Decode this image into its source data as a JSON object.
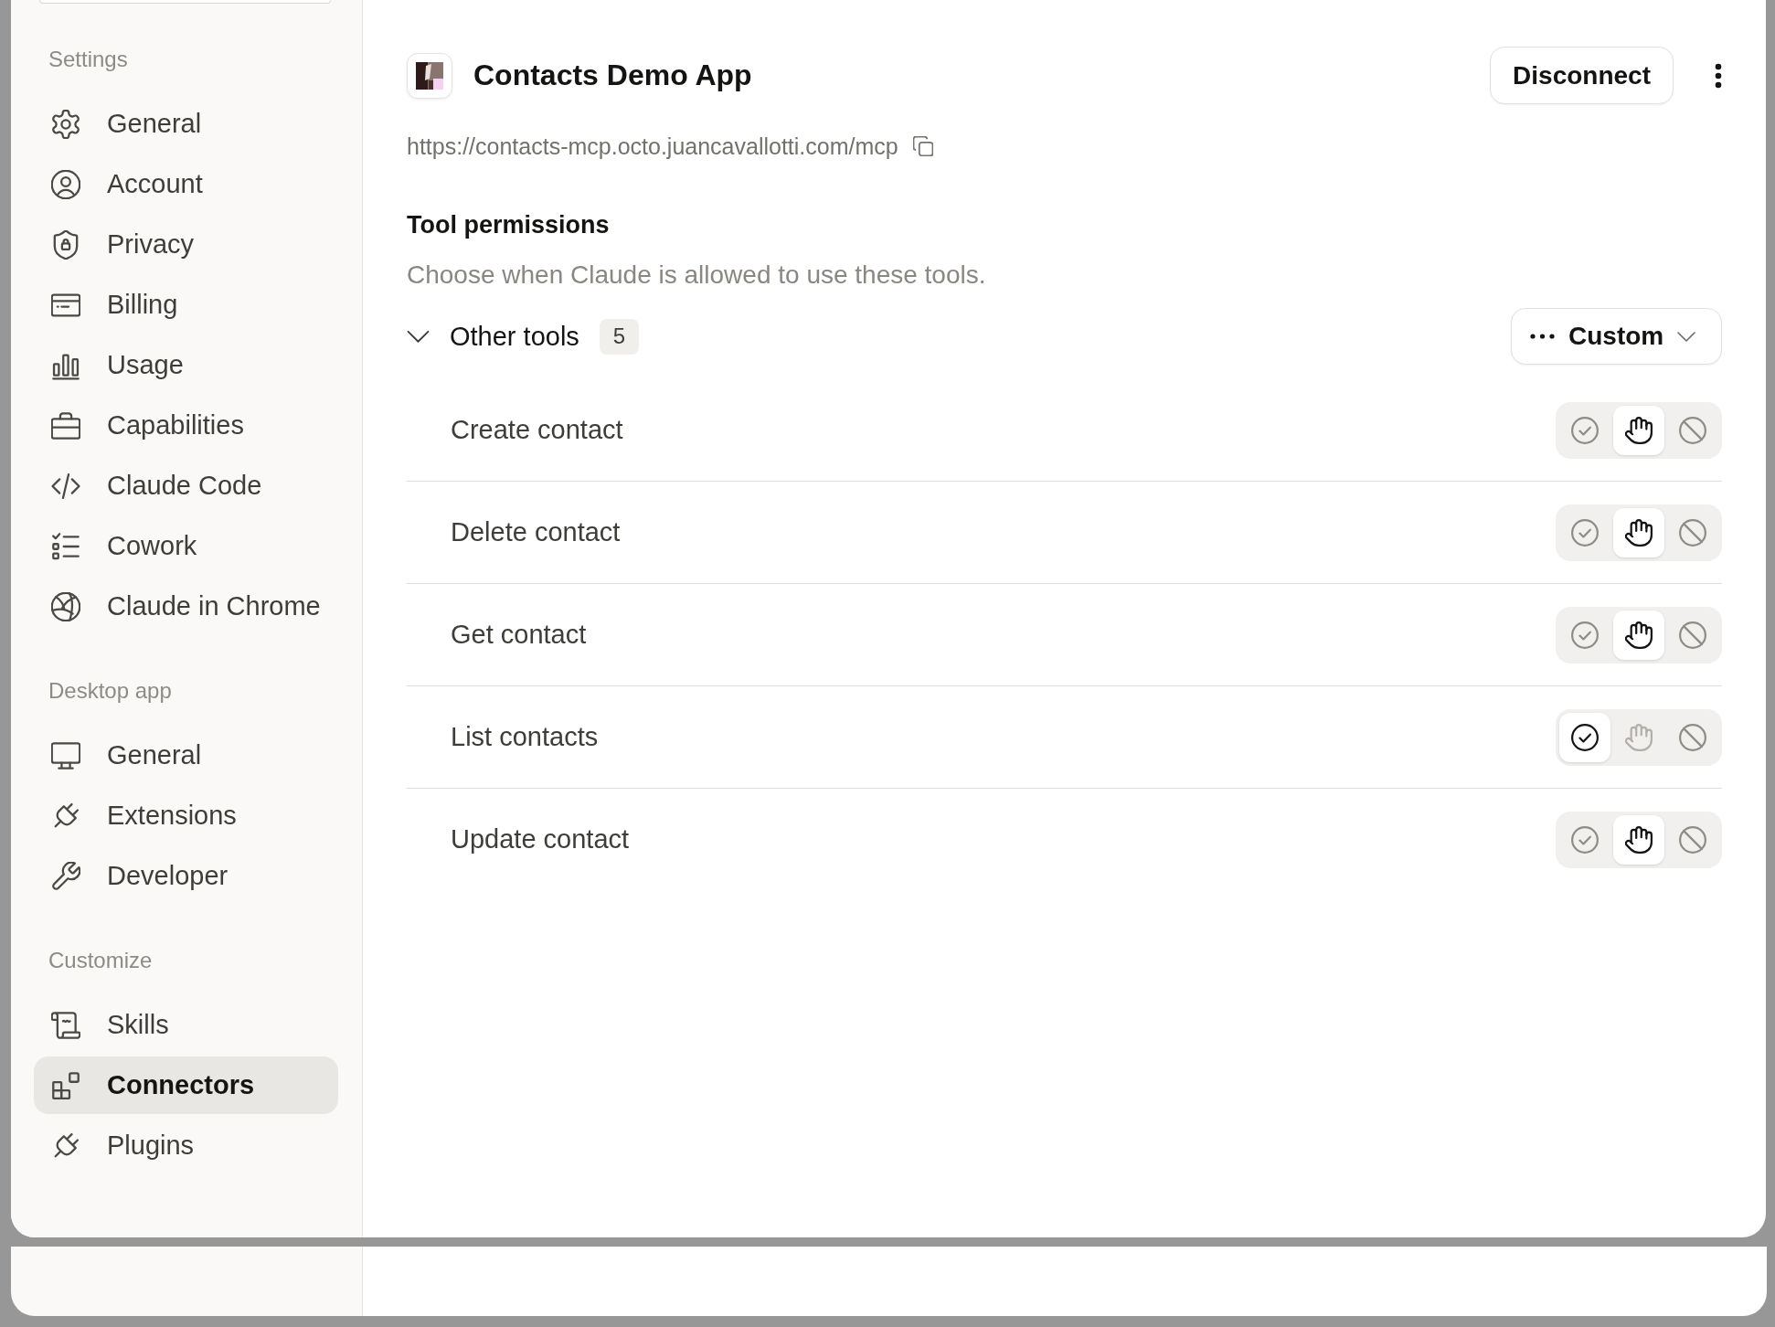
{
  "sidebar": {
    "sections": [
      {
        "title": "Settings",
        "items": [
          {
            "label": "General",
            "selected": false
          },
          {
            "label": "Account",
            "selected": false
          },
          {
            "label": "Privacy",
            "selected": false
          },
          {
            "label": "Billing",
            "selected": false
          },
          {
            "label": "Usage",
            "selected": false
          },
          {
            "label": "Capabilities",
            "selected": false
          },
          {
            "label": "Claude Code",
            "selected": false
          },
          {
            "label": "Cowork",
            "selected": false
          },
          {
            "label": "Claude in Chrome",
            "selected": false
          }
        ]
      },
      {
        "title": "Desktop app",
        "items": [
          {
            "label": "General",
            "selected": false
          },
          {
            "label": "Extensions",
            "selected": false
          },
          {
            "label": "Developer",
            "selected": false
          }
        ]
      },
      {
        "title": "Customize",
        "items": [
          {
            "label": "Skills",
            "selected": false
          },
          {
            "label": "Connectors",
            "selected": true
          },
          {
            "label": "Plugins",
            "selected": false
          }
        ]
      }
    ]
  },
  "connector": {
    "name": "Contacts Demo App",
    "url": "https://contacts-mcp.octo.juancavallotti.com/mcp",
    "disconnect_button": "Disconnect"
  },
  "tool_permissions": {
    "title": "Tool permissions",
    "description": "Choose when Claude is allowed to use these tools.",
    "groups": [
      {
        "label": "Other tools",
        "count": "5",
        "expanded": true,
        "mode": "Custom",
        "tools": [
          {
            "name": "Create contact",
            "options": [
              {
                "kind": "allow",
                "selected": false
              },
              {
                "kind": "ask",
                "selected": true
              },
              {
                "kind": "block",
                "selected": false
              }
            ]
          },
          {
            "name": "Delete contact",
            "options": [
              {
                "kind": "allow",
                "selected": false
              },
              {
                "kind": "ask",
                "selected": true
              },
              {
                "kind": "block",
                "selected": false
              }
            ]
          },
          {
            "name": "Get contact",
            "options": [
              {
                "kind": "allow",
                "selected": false
              },
              {
                "kind": "ask",
                "selected": true
              },
              {
                "kind": "block",
                "selected": false
              }
            ]
          },
          {
            "name": "List contacts",
            "options": [
              {
                "kind": "allow",
                "selected": true
              },
              {
                "kind": "ask",
                "selected": false
              },
              {
                "kind": "block",
                "selected": false
              }
            ]
          },
          {
            "name": "Update contact",
            "options": [
              {
                "kind": "allow",
                "selected": false
              },
              {
                "kind": "ask",
                "selected": true
              },
              {
                "kind": "block",
                "selected": false
              }
            ]
          }
        ]
      }
    ]
  }
}
